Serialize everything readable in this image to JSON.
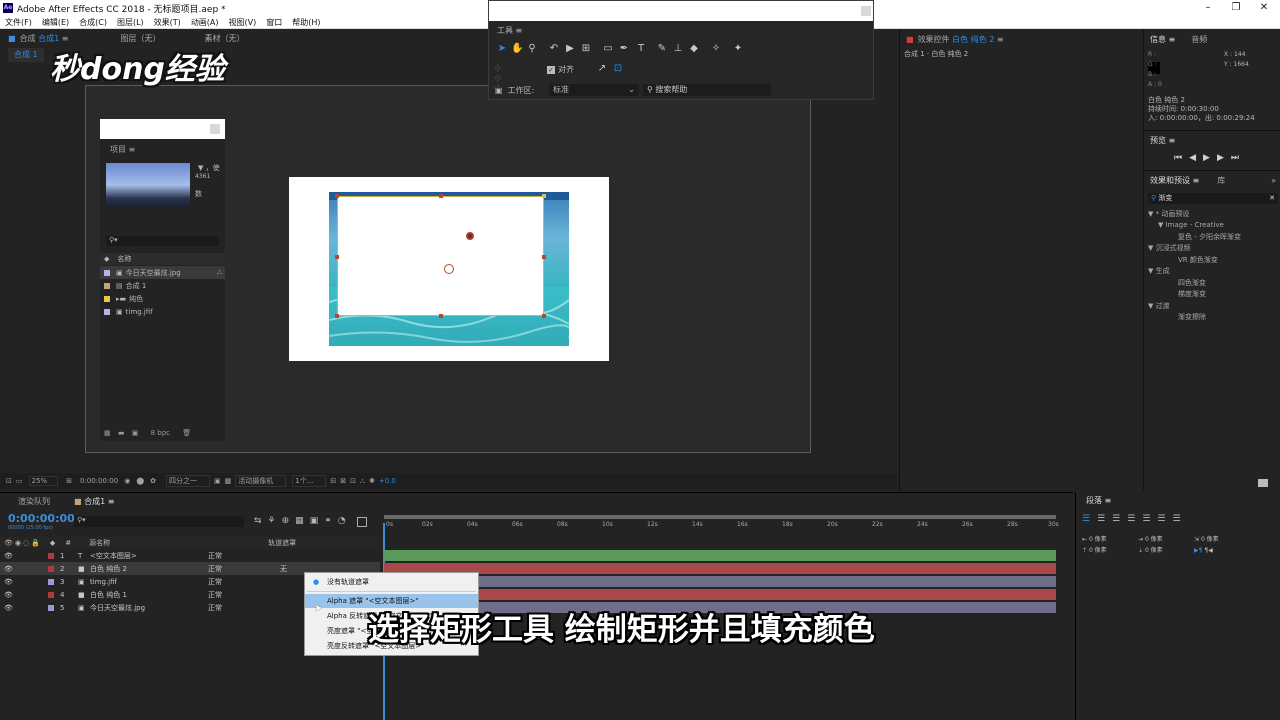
{
  "window": {
    "title": "Adobe After Effects CC 2018 - 无标题项目.aep *",
    "app_icon": "Ae"
  },
  "menu": [
    "文件(F)",
    "编辑(E)",
    "合成(C)",
    "图层(L)",
    "效果(T)",
    "动画(A)",
    "视图(V)",
    "窗口",
    "帮助(H)"
  ],
  "comp_tabs": {
    "comp_label": "合成",
    "comp_name": "合成1",
    "layer_label": "图层（无）",
    "footage_label": "素材（无）",
    "sub_tab": "合成 1"
  },
  "watermark": "秒dong经验",
  "tools_panel": {
    "title": "工具",
    "align_label": "对齐",
    "workspace_label": "工作区:",
    "workspace_value": "标准",
    "search_placeholder": "搜索帮助"
  },
  "project_panel": {
    "title": "项目",
    "thumb_info_1": "，使",
    "thumb_info_2": "4361",
    "thumb_info_3": "数",
    "name_header": "名称",
    "items": [
      {
        "name": "今日天空最炫.jpg",
        "color": "#b4b4e6"
      },
      {
        "name": "合成 1",
        "color": "#c4a27a"
      },
      {
        "name": "纯色",
        "color": "#e6c84c"
      },
      {
        "name": "timg.jfif",
        "color": "#b4b4e6"
      }
    ],
    "bpc": "8 bpc"
  },
  "effect_controls": {
    "title": "效果控件",
    "layer": "白色 纯色 2",
    "subtitle": "合成 1 · 白色 纯色 2"
  },
  "info_panel": {
    "title": "信息",
    "audio_tab": "音频",
    "r": "R :",
    "g": "G :",
    "b": "B :",
    "a": "A : 0",
    "x": "X : 144",
    "y": "Y : 1664",
    "layer_name": "白色 纯色 2",
    "duration": "持续时间: 0:00:30:00",
    "in_out": "入: 0:00:00:00，出: 0:00:29:24"
  },
  "preview_panel": {
    "title": "预览"
  },
  "effects_panel": {
    "title": "效果和预设",
    "lib_tab": "库",
    "search_value": "渐变",
    "tree": [
      {
        "label": "▼ * 动画预设",
        "indent": 0
      },
      {
        "label": "▼ Image - Creative",
        "indent": 1
      },
      {
        "label": "复色 - 夕阳余晖渐变",
        "indent": 2
      },
      {
        "label": "▼ 沉浸式视频",
        "indent": 0
      },
      {
        "label": "VR 颜色渐变",
        "indent": 2
      },
      {
        "label": "▼ 生成",
        "indent": 0
      },
      {
        "label": "四色渐变",
        "indent": 2
      },
      {
        "label": "梯度渐变",
        "indent": 2
      },
      {
        "label": "▼ 过渡",
        "indent": 0
      },
      {
        "label": "渐变擦除",
        "indent": 2
      }
    ]
  },
  "viewer_bar": {
    "zoom": "25%",
    "timecode": "0:00:00:00",
    "resolution": "四分之一",
    "camera": "活动摄像机",
    "views": "1个...",
    "exposure": "+0.0"
  },
  "timeline": {
    "render_queue_tab": "渲染队列",
    "comp_tab": "合成1",
    "current_time": "0:00:00:00",
    "fps": "00000 (25.00 fps)",
    "col_source": "源名称",
    "col_trkmat": "轨道遮罩",
    "ruler": [
      "0s",
      "02s",
      "04s",
      "06s",
      "08s",
      "10s",
      "12s",
      "14s",
      "16s",
      "18s",
      "20s",
      "22s",
      "24s",
      "26s",
      "28s",
      "30s"
    ],
    "layers": [
      {
        "num": "1",
        "name": "<空文本图层>",
        "mode": "正常",
        "trk": "",
        "color": "#b13b3b",
        "track_color": "#5a9a5a",
        "type": "T"
      },
      {
        "num": "2",
        "name": "白色 纯色 2",
        "mode": "正常",
        "trk": "无",
        "color": "#b13b3b",
        "track_color": "#a84848",
        "type": "■"
      },
      {
        "num": "3",
        "name": "timg.jfif",
        "mode": "正常",
        "trk": "",
        "color": "#9a9ad6",
        "track_color": "#6e6e8a",
        "type": "▣"
      },
      {
        "num": "4",
        "name": "白色 纯色 1",
        "mode": "正常",
        "trk": "",
        "color": "#b13b3b",
        "track_color": "#a84848",
        "type": "■"
      },
      {
        "num": "5",
        "name": "今日天空最炫.jpg",
        "mode": "正常",
        "trk": "",
        "color": "#9a9ad6",
        "track_color": "#6e6e8a",
        "type": "▣"
      }
    ]
  },
  "paragraph_panel": {
    "title": "段落",
    "px_label_1": "0 像素",
    "px_label_2": "0 像素",
    "px_label_3": "0 像素",
    "px_label_4": "0 像素",
    "px_label_5": "0 像素"
  },
  "track_matte_dropdown": {
    "options": [
      {
        "label": "没有轨道遮罩",
        "selected": true
      },
      {
        "label": "Alpha 遮罩 \"<空文本图层>\"",
        "selected": false,
        "hover": true
      },
      {
        "label": "Alpha 反转遮罩 \"<空文本图层>\"",
        "selected": false
      },
      {
        "label": "亮度遮罩 \"<空文本图层>\"",
        "selected": false
      },
      {
        "label": "亮度反转遮罩 \"<空文本图层>\"",
        "selected": false
      }
    ]
  },
  "caption": "选择矩形工具 绘制矩形并且填充颜色",
  "colors": {
    "accent": "#2d8ceb",
    "panel_bg": "#232323",
    "timecode": "#3d8ed8"
  }
}
